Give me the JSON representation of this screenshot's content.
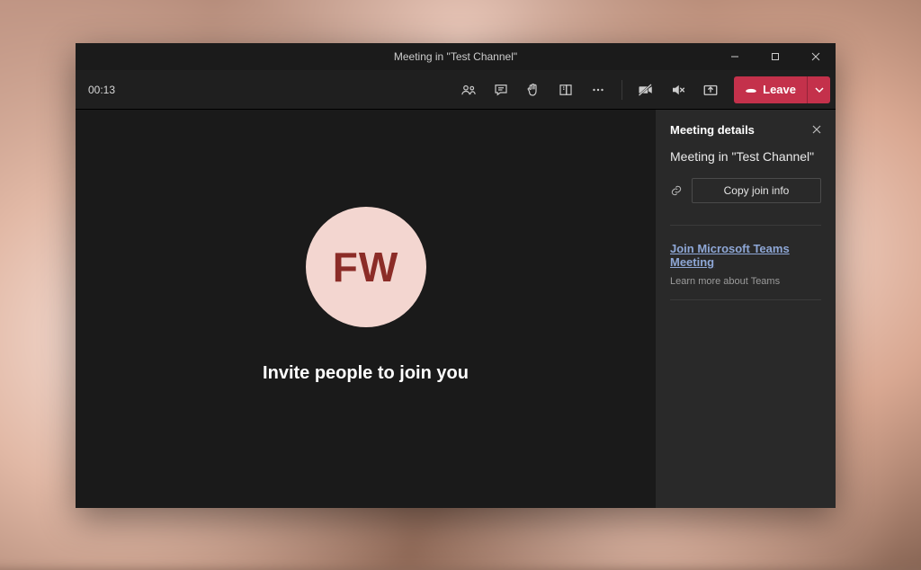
{
  "window": {
    "title": "Meeting in \"Test Channel\""
  },
  "toolbar": {
    "timer": "00:13",
    "leave_label": "Leave"
  },
  "stage": {
    "avatar_initials": "FW",
    "invite_text": "Invite people to join you"
  },
  "sidepanel": {
    "title": "Meeting details",
    "meeting_name": "Meeting in \"Test Channel\"",
    "copy_button_label": "Copy join info",
    "join_link_label": "Join Microsoft Teams Meeting",
    "learn_more_label": "Learn more about Teams"
  }
}
